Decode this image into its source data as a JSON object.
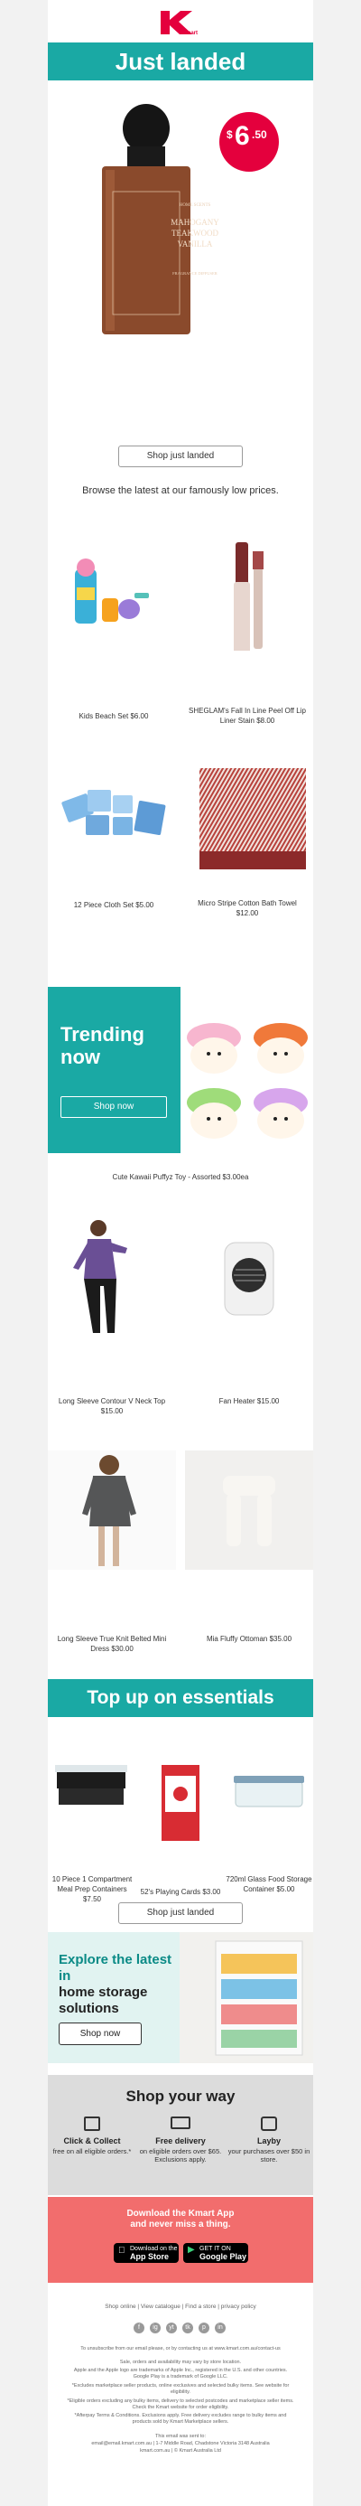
{
  "brand": {
    "name": "Kmart",
    "accent": "#e4003d",
    "teal": "#1aa9a4"
  },
  "hero": {
    "banner": "Just landed",
    "price_dollar": "$",
    "price_main": "6",
    "price_cents": ".50",
    "bottle_text_1": "HOME SCENTS",
    "bottle_text_2": "MAHOGANY TEAKWOOD VANILLA",
    "bottle_text_3": "FRAGRANCE DIFFUSER",
    "cta": "Shop just landed"
  },
  "tagline": "Browse the latest at our famously low prices.",
  "products": [
    {
      "label": "Kids Beach Set $6.00"
    },
    {
      "label": "SHEGLAM's Fall In Line Peel Off Lip Liner Stain $8.00"
    },
    {
      "label": "12 Piece Cloth Set $5.00"
    },
    {
      "label": "Micro Stripe Cotton Bath Towel $12.00"
    }
  ],
  "trending": {
    "title": "Trending now",
    "cta": "Shop now",
    "caption": "Cute Kawaii Puffyz Toy - Assorted $3.00ea"
  },
  "products2": [
    {
      "label": "Long Sleeve Contour V Neck Top $15.00"
    },
    {
      "label": "Fan Heater $15.00"
    },
    {
      "label": "Long Sleeve True Knit Belted Mini Dress $30.00"
    },
    {
      "label": "Mia Fluffy Ottoman $35.00"
    }
  ],
  "essentials": {
    "banner": "Top up on essentials",
    "items": [
      {
        "label": "10 Piece 1 Compartment Meal Prep Containers $7.50"
      },
      {
        "label": "52's Playing Cards $3.00"
      },
      {
        "label": "720ml Glass Food Storage Container $5.00"
      }
    ],
    "cta": "Shop just landed"
  },
  "storage": {
    "line1": "Explore the latest in",
    "line2": "home storage solutions",
    "cta": "Shop now"
  },
  "shop_way": {
    "title": "Shop your way",
    "options": [
      {
        "title": "Click & Collect",
        "sub": "free on all eligible orders.*",
        "icon": "click-collect-icon"
      },
      {
        "title": "Free delivery",
        "sub": "on eligible orders over $65. Exclusions apply.",
        "icon": "delivery-truck-icon"
      },
      {
        "title": "Layby",
        "sub": "your purchases over $50 in store.",
        "icon": "layby-bag-icon"
      }
    ]
  },
  "app": {
    "line1": "Download the Kmart App",
    "line2": "and never miss a thing.",
    "appstore_small": "Download on the",
    "appstore_big": "App Store",
    "play_small": "GET IT ON",
    "play_big": "Google Play"
  },
  "footer": {
    "links": "Shop online  |  View catalogue  |  Find a store  |  privacy policy",
    "social": [
      "f",
      "ig",
      "yt",
      "tk",
      "p",
      "in"
    ],
    "fine1": "To unsubscribe from our email please, or by contacting us at www.kmart.com.au/contact-us",
    "fine2": "Sale, orders and availability may vary by store location.",
    "fine3": "Apple and the Apple logo are trademarks of Apple Inc., registered in the U.S. and other countries. Google Play is a trademark of Google LLC.",
    "fine4": "*Excludes marketplace seller products, online exclusives and selected bulky items. See website for eligibility.",
    "fine5": "*Eligible orders excluding any bulky items, delivery to selected postcodes and marketplace seller items. Check the Kmart website for order eligibility.",
    "fine6": "*Afterpay Terms & Conditions. Exclusions apply. Free delivery excludes range to bulky items and products sold by Kmart Marketplace sellers.",
    "fine7": "This email was sent to:",
    "fine8": "email@email.kmart.com.au | 1-7 Middle Road, Chadstone Victoria 3148 Australia",
    "fine9": "kmart.com.au | © Kmart Australia Ltd"
  }
}
